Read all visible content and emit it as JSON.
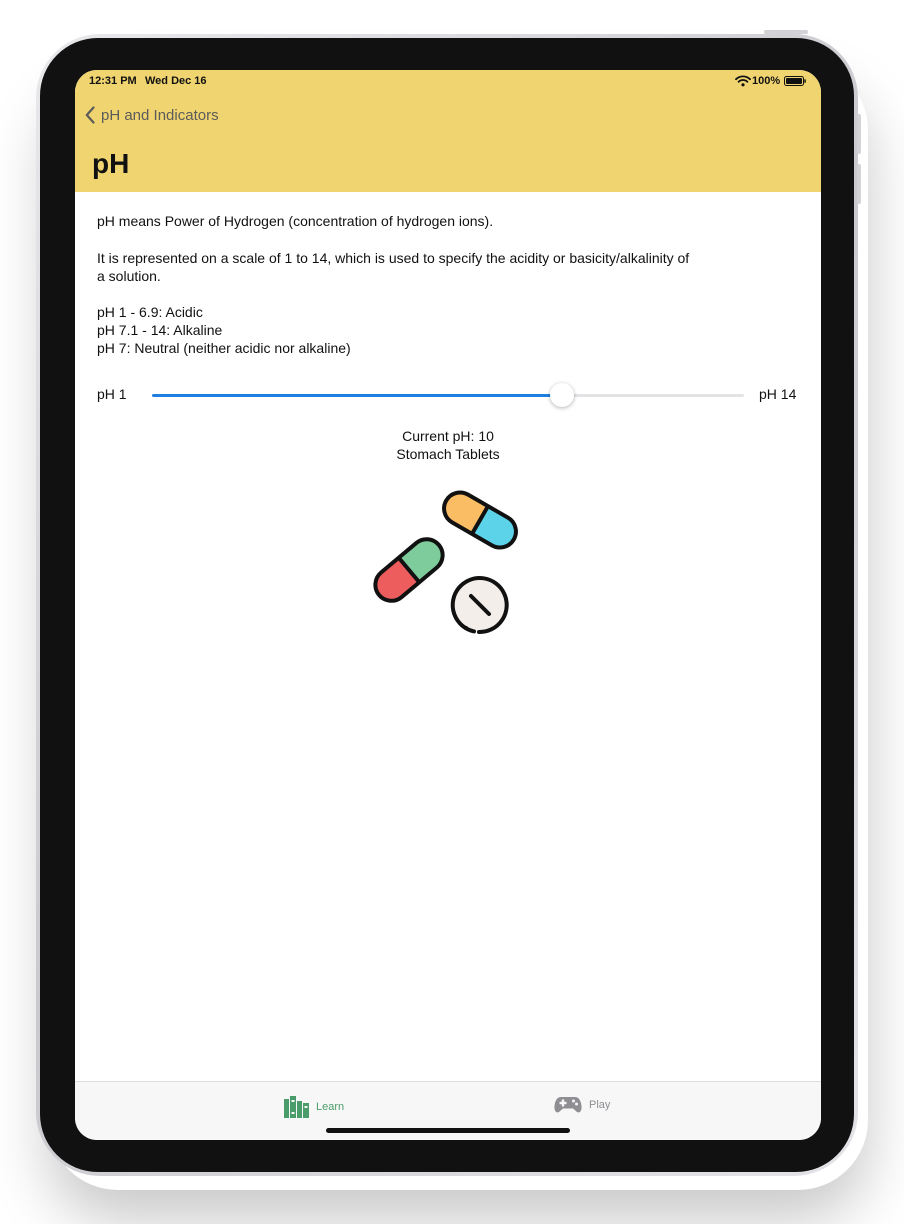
{
  "status_bar": {
    "time": "12:31 PM",
    "date": "Wed Dec 16",
    "battery": "100%"
  },
  "nav": {
    "back_label": "pH and Indicators",
    "title": "pH"
  },
  "content": {
    "intro": "pH means Power of Hydrogen (concentration of hydrogen ions).",
    "scale_line1": "It is represented on a scale of 1 to 14, which is used to specify the acidity or basicity/alkalinity of",
    "scale_line2": "a solution.",
    "acidic": "pH 1 - 6.9: Acidic",
    "alkaline": "pH 7.1 - 14:  Alkaline",
    "neutral": "pH 7: Neutral (neither acidic nor alkaline)"
  },
  "slider": {
    "min_label": "pH 1",
    "max_label": "pH 14",
    "min": 1,
    "max": 14,
    "value": 10
  },
  "result": {
    "current_label": "Current pH: 10",
    "example": "Stomach Tablets"
  },
  "tabs": [
    {
      "label": "Learn",
      "icon": "books-icon",
      "active": true
    },
    {
      "label": "Play",
      "icon": "gamepad-icon",
      "active": false
    }
  ],
  "colors": {
    "header": "#f0d46f",
    "accent": "#1f7fe0",
    "tab_active": "#4a9d6b",
    "tab_inactive": "#8e8e93"
  }
}
